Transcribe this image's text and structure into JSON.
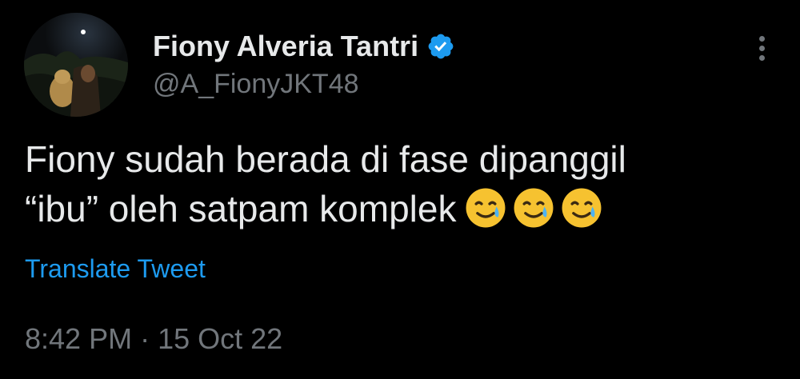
{
  "author": {
    "display_name": "Fiony Alveria Tantri",
    "handle": "@A_FionyJKT48",
    "verified_icon": "verified-badge-icon",
    "avatar": "profile-avatar"
  },
  "tweet": {
    "text_line1": "Fiony sudah berada di fase dipanggil",
    "text_line2": "“ibu” oleh satpam komplek",
    "emojis": [
      "smiling-face-with-tear-icon",
      "smiling-face-with-tear-icon",
      "smiling-face-with-tear-icon"
    ]
  },
  "actions": {
    "translate_label": "Translate Tweet",
    "more_icon": "more-options-icon"
  },
  "meta": {
    "time": "8:42 PM",
    "separator": "·",
    "date": "15 Oct 22"
  },
  "colors": {
    "background": "#000000",
    "primary_text": "#e7e9ea",
    "secondary_text": "#71767b",
    "link": "#1d9bf0",
    "verified": "#1d9bf0"
  }
}
